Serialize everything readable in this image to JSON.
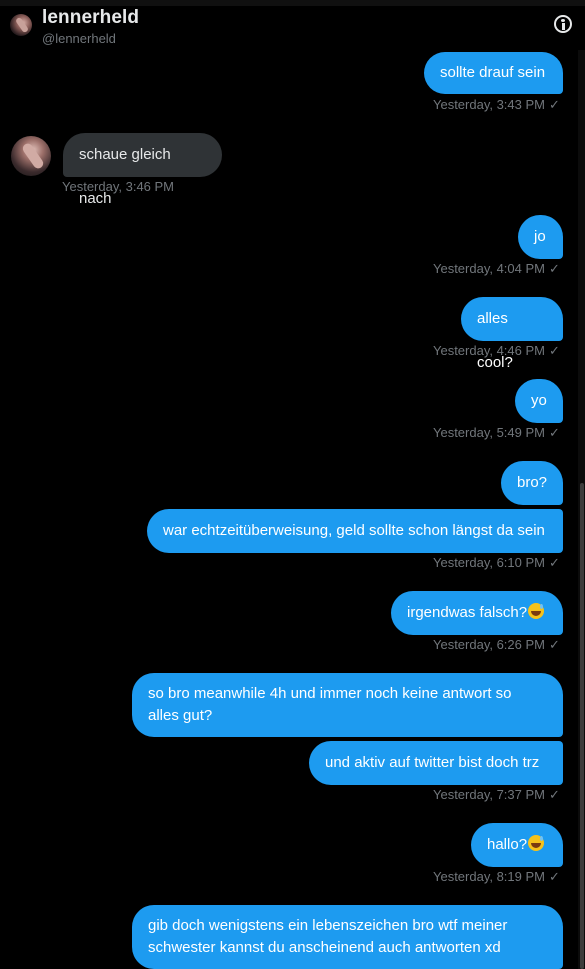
{
  "header": {
    "name": "lennerheld",
    "handle": "@lennerheld",
    "info_icon": "info-icon"
  },
  "messages": [
    {
      "dir": "out",
      "text": "sollte drauf sein",
      "time": "Yesterday, 3:43 PM"
    },
    {
      "dir": "in",
      "text": "schaue gleich nach",
      "time": "Yesterday, 3:46 PM"
    },
    {
      "dir": "out",
      "text": "jo",
      "time": "Yesterday, 4:04 PM"
    },
    {
      "dir": "out",
      "text": "alles cool?",
      "time": "Yesterday, 4:46 PM"
    },
    {
      "dir": "out",
      "text": "yo",
      "time": "Yesterday, 5:49 PM"
    },
    {
      "dir": "out",
      "text": "bro?",
      "time": ""
    },
    {
      "dir": "out",
      "text": "war echtzeitüberweisung, geld sollte schon längst da sein",
      "time": "Yesterday, 6:10 PM"
    },
    {
      "dir": "out",
      "text": "irgendwas falsch?",
      "emoji": "grinning-sweat-emoji",
      "time": "Yesterday, 6:26 PM"
    },
    {
      "dir": "out",
      "line1": "so bro meanwhile  4h und immer noch keine antwort so",
      "line2": "alles gut?",
      "time": ""
    },
    {
      "dir": "out",
      "text": "und aktiv auf twitter bist doch trz",
      "time": "Yesterday, 7:37 PM"
    },
    {
      "dir": "out",
      "text": "hallo?",
      "emoji": "grinning-sweat-emoji",
      "time": "Yesterday, 8:19 PM"
    },
    {
      "dir": "out",
      "line1": "gib doch wenigstens ein lebenszeichen bro wtf meiner",
      "line2": "schwester kannst du anscheinend auch antworten  xd",
      "time": ""
    }
  ],
  "read_mark": "✓",
  "colors": {
    "outgoing": "#1d9bf0",
    "incoming": "#2f3336",
    "timestamp": "#71767b",
    "background": "#000000"
  }
}
